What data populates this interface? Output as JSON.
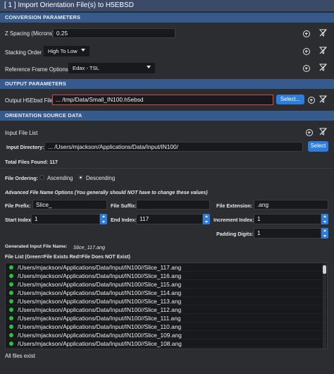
{
  "window": {
    "title": "[ 1 ] Import Orientation File(s) to H5EBSD"
  },
  "sections": {
    "conversion": "CONVERSION PARAMETERS",
    "output": "OUTPUT PARAMETERS",
    "source": "ORIENTATION SOURCE DATA"
  },
  "conversion": {
    "z_spacing_label": "Z Spacing (Microns)",
    "z_spacing_value": "0.25",
    "stacking_label": "Stacking Order",
    "stacking_value": "High To Low",
    "ref_frame_label": "Reference Frame Options",
    "ref_frame_value": "Edax - TSL"
  },
  "output": {
    "file_label": "Output H5Ebsd File",
    "file_value": "...  /tmp/Data/Small_IN100.h5ebsd",
    "select_label": "Select..."
  },
  "source": {
    "input_list_label": "Input File List",
    "input_dir_label": "Input Directory:",
    "input_dir_value": "...  /Users/mjackson/Applications/Data/Input/IN100/",
    "select_label": "Select",
    "total_files": "Total Files Found:  117",
    "ordering_label": "File Ordering:",
    "ascending": "Ascending",
    "descending": "Descending",
    "advanced_note": "Advanced File Name Options (You generally should NOT have to change these values)",
    "prefix_label": "File Prefix:",
    "prefix_value": "Slice_",
    "suffix_label": "File Suffix:",
    "suffix_value": "",
    "extension_label": "File Extension:",
    "extension_value": ".ang",
    "start_label": "Start Index:",
    "start_value": "1",
    "end_label": "End Index:",
    "end_value": "117",
    "increment_label": "Increment Index:",
    "increment_value": "1",
    "padding_label": "Padding Digits:",
    "padding_value": "1",
    "generated_label": "Generated Input File Name:",
    "generated_value": "Slice_117.ang",
    "file_list_label": "File List (Green=File Exists  Red=File Does NOT Exist)",
    "files": [
      "/Users/mjackson/Applications/Data/Input/IN100//Slice_117.ang",
      "/Users/mjackson/Applications/Data/Input/IN100//Slice_116.ang",
      "/Users/mjackson/Applications/Data/Input/IN100//Slice_115.ang",
      "/Users/mjackson/Applications/Data/Input/IN100//Slice_114.ang",
      "/Users/mjackson/Applications/Data/Input/IN100//Slice_113.ang",
      "/Users/mjackson/Applications/Data/Input/IN100//Slice_112.ang",
      "/Users/mjackson/Applications/Data/Input/IN100//Slice_111.ang",
      "/Users/mjackson/Applications/Data/Input/IN100//Slice_110.ang",
      "/Users/mjackson/Applications/Data/Input/IN100//Slice_109.ang",
      "/Users/mjackson/Applications/Data/Input/IN100//Slice_108.ang"
    ],
    "status": "All files exist"
  },
  "icons": {
    "add": "add-circle-icon",
    "remove": "remove-filter-icon"
  },
  "colors": {
    "section_header": "#375a8c",
    "accent": "#2d7ddf",
    "file_exists": "#2fbf40",
    "error_border": "#e0443e"
  }
}
